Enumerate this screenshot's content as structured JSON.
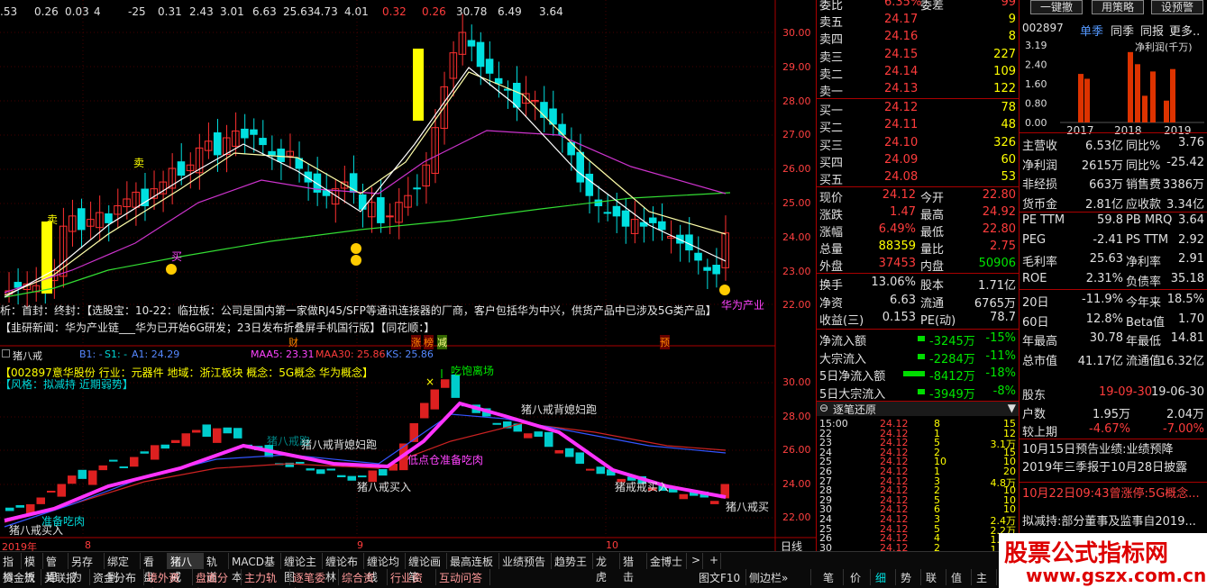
{
  "top_values": [
    {
      "t": ".53",
      "c": "w"
    },
    {
      "t": "0.26",
      "c": "w"
    },
    {
      "t": "0.03",
      "c": "w"
    },
    {
      "t": "4",
      "c": "w"
    },
    {
      "t": "-25",
      "c": "w"
    },
    {
      "t": "0.31",
      "c": "w"
    },
    {
      "t": "2.43",
      "c": "w"
    },
    {
      "t": "3.01",
      "c": "w"
    },
    {
      "t": "6.63",
      "c": "w"
    },
    {
      "t": "25.63",
      "c": "w"
    },
    {
      "t": "4.73",
      "c": "w"
    },
    {
      "t": "4.01",
      "c": "w"
    },
    {
      "t": "0.32",
      "c": "r"
    },
    {
      "t": "0.26",
      "c": "r"
    },
    {
      "t": "30.78",
      "c": "w"
    },
    {
      "t": "6.49",
      "c": "w"
    },
    {
      "t": "3.64",
      "c": "w"
    }
  ],
  "price_axis": [
    "30.00",
    "29.00",
    "28.00",
    "27.00",
    "26.00",
    "25.00",
    "24.00",
    "23.00",
    "22.00"
  ],
  "main_labels": {
    "sell": "卖",
    "sell2": "卖",
    "buy": "买",
    "buy2": "买",
    "huawei": "华为产业"
  },
  "ticker_line1": "析：首封：终封：【选股宝：10-22：临拉板：公司是国内第一家做RJ45/SFP等通讯连接器的厂商，客户包括华为中兴，供货产品中已涉及5G类产品】",
  "ticker_line2": "【韭研新闻：华为产业链___华为已开始6G研发；23日发布折叠屏手机国行版】【同花顺：】",
  "event_marks": {
    "cai": "财",
    "zhang": "涨",
    "lv": "榜",
    "jian": "减",
    "yu": "预"
  },
  "sub_header": {
    "name": "猪八戒",
    "b1": "B1: -",
    "s1": "S1: -",
    "a1": "A1: 24.29",
    "maa5": "MAA5: 23.31",
    "maa30": "MAA30: 25.86",
    "ks": "KS: 25.86"
  },
  "sub_info1": "【002897意华股份 行业：元器件 地域：浙江板块 概念：5G概念 华为概念】",
  "sub_info2": "【风格：拟减持 近期弱势】",
  "sub_axis": [
    "30.00",
    "28.00",
    "26.00",
    "24.00",
    "22.00"
  ],
  "sub_labels": {
    "eat": "吃饱离场",
    "back1": "猪八戒背媳妇跑",
    "back2": "猪八戒背媳妇跑",
    "buy1": "猪八戒买入",
    "buy2": "猪八戒买入",
    "buy3": "猪戒戒买入",
    "buy4": "猪八戒买",
    "ready1": "准备吃肉",
    "ready2": "低点仓准备吃肉",
    "flash": "猪八戒跑"
  },
  "date_axis": {
    "y2019": "2019年",
    "m8": "8",
    "m9": "9",
    "m10": "10",
    "daily": "日线"
  },
  "tabs1": [
    "指标",
    "模板",
    "管理",
    "另存为",
    "绑定到",
    "看盘",
    "猪八戒",
    "轨道",
    "MACD基本",
    "缠论主图",
    "缠论布林",
    "缠论均线",
    "缠论画笔",
    "最高连板",
    "业绩预告",
    "趋势王",
    "龙虎",
    "猎击",
    "金博士"
  ],
  "tabs2": [
    "资金流入",
    "关联报价",
    "资金分布",
    "境外资金",
    "盘面分析",
    "主力轨迹",
    "逐笔委托",
    "综合资讯",
    "行业资讯",
    "互动问答"
  ],
  "tabs3": [
    "图文F10",
    "侧边栏»"
  ],
  "tabs4": [
    "笔",
    "价",
    "细",
    "势",
    "联",
    "值",
    "主"
  ],
  "orderbook_sell": [
    {
      "l": "卖五",
      "p": "24.17",
      "v": "9"
    },
    {
      "l": "卖四",
      "p": "24.16",
      "v": "8"
    },
    {
      "l": "卖三",
      "p": "24.15",
      "v": "227"
    },
    {
      "l": "卖二",
      "p": "24.14",
      "v": "109"
    },
    {
      "l": "卖一",
      "p": "24.13",
      "v": "122"
    }
  ],
  "orderbook_buy": [
    {
      "l": "买一",
      "p": "24.12",
      "v": "78"
    },
    {
      "l": "买二",
      "p": "24.11",
      "v": "48"
    },
    {
      "l": "买三",
      "p": "24.10",
      "v": "326"
    },
    {
      "l": "买四",
      "p": "24.09",
      "v": "60"
    },
    {
      "l": "买五",
      "p": "24.08",
      "v": "53"
    }
  ],
  "weibi": {
    "l": "委比",
    "v": "6.35%",
    "l2": "委差",
    "v2": "99"
  },
  "quote": [
    {
      "l": "现价",
      "v": "24.12",
      "c": "r",
      "l2": "今开",
      "v2": "22.80",
      "c2": "r"
    },
    {
      "l": "涨跌",
      "v": "1.47",
      "c": "r",
      "l2": "最高",
      "v2": "24.92",
      "c2": "r"
    },
    {
      "l": "涨幅",
      "v": "6.49%",
      "c": "r",
      "l2": "最低",
      "v2": "22.80",
      "c2": "r"
    },
    {
      "l": "总量",
      "v": "88359",
      "c": "y",
      "l2": "量比",
      "v2": "2.75",
      "c2": "r"
    },
    {
      "l": "外盘",
      "v": "37453",
      "c": "r",
      "l2": "内盘",
      "v2": "50906",
      "c2": "g"
    }
  ],
  "quote2": [
    {
      "l": "换手",
      "v": "13.06%",
      "l2": "股本",
      "v2": "1.71亿"
    },
    {
      "l": "净资",
      "v": "6.63",
      "l2": "流通",
      "v2": "6765万"
    },
    {
      "l": "收益(三)",
      "v": "0.153",
      "l2": "PE(动)",
      "v2": "78.7"
    }
  ],
  "flows": [
    {
      "l": "净流入额",
      "v": "-3245万",
      "p": "-15%"
    },
    {
      "l": "大宗流入",
      "v": "-2284万",
      "p": "-11%"
    },
    {
      "l": "5日净流入额",
      "v": "-8412万",
      "p": "-18%"
    },
    {
      "l": "5日大宗流入",
      "v": "-3949万",
      "p": "-8%"
    }
  ],
  "tick_header": "逐笔还原",
  "ticks": [
    {
      "t": "15:00",
      "p": "24.12",
      "v": "8",
      "x": "15"
    },
    {
      "t": "22",
      "p": "24.12",
      "v": "1",
      "x": "12"
    },
    {
      "t": "23",
      "p": "24.12",
      "v": "5",
      "x": "3.1万"
    },
    {
      "t": "24",
      "p": "24.12",
      "v": "2",
      "x": "15"
    },
    {
      "t": "25",
      "p": "24.12",
      "v": "10",
      "x": "10"
    },
    {
      "t": "26",
      "p": "24.12",
      "v": "1",
      "x": "20"
    },
    {
      "t": "27",
      "p": "24.12",
      "v": "3",
      "x": "4.8万"
    },
    {
      "t": "28",
      "p": "24.12",
      "v": "2",
      "x": "10"
    },
    {
      "t": "29",
      "p": "24.12",
      "v": "5",
      "x": "10"
    },
    {
      "t": "30",
      "p": "24.12",
      "v": "6",
      "x": "10"
    },
    {
      "t": "24",
      "p": "24.12",
      "v": "3",
      "x": "2.4万"
    },
    {
      "t": "25",
      "p": "24.12",
      "v": "5",
      "x": "2.2万"
    },
    {
      "t": "26",
      "p": "24.12",
      "v": "4",
      "x": "1.0万"
    },
    {
      "t": "30",
      "p": "24.12",
      "v": "2",
      "x": "1.0万"
    }
  ],
  "fin": {
    "b1": "一键撤",
    "b2": "用策略",
    "b3": "设预警",
    "code": "002897",
    "tab1": "单季",
    "tab2": "同季",
    "tab3": "同报",
    "tab4": "更多..",
    "chart_label": "净利润(千万)",
    "y_axis": [
      "3.19",
      "2.40",
      "1.60",
      "0.80",
      "0.00"
    ],
    "years": [
      "2017",
      "2018",
      "2019"
    ]
  },
  "chart_data": {
    "type": "bar",
    "title": "净利润(千万)",
    "categories": [
      "2017",
      "2018",
      "2019"
    ],
    "values": [
      2.0,
      1.8,
      2.9,
      2.4,
      1.1,
      2.1,
      0.9,
      2.2
    ],
    "ylim": [
      0,
      3.19
    ]
  },
  "fin_rows": [
    {
      "l": "主营收",
      "v": "6.53亿",
      "l2": "同比%",
      "v2": "3.76"
    },
    {
      "l": "净利润",
      "v": "2615万",
      "l2": "同比%",
      "v2": "-25.42"
    },
    {
      "l": "非经损",
      "v": "663万",
      "l2": "销售费",
      "v2": "3386万"
    },
    {
      "l": "货币金",
      "v": "2.81亿",
      "l2": "应收款",
      "v2": "3.34亿"
    },
    {
      "l": "PE TTM",
      "v": "59.8",
      "l2": "PB MRQ",
      "v2": "3.64"
    },
    {
      "l": "PEG",
      "v": "-2.41",
      "l2": "PS TTM",
      "v2": "2.92"
    },
    {
      "l": "毛利率",
      "v": "25.63",
      "l2": "净利率",
      "v2": "2.91"
    },
    {
      "l": "ROE",
      "v": "2.31%",
      "l2": "负债率",
      "v2": "35.18"
    },
    {
      "l": "20日",
      "v": "-11.9%",
      "l2": "今年来",
      "v2": "18.5%"
    },
    {
      "l": "60日",
      "v": "12.8%",
      "l2": "Beta值",
      "v2": "1.70"
    },
    {
      "l": "年最高",
      "v": "30.78",
      "l2": "年最低",
      "v2": "14.81"
    },
    {
      "l": "总市值",
      "v": "41.17亿",
      "l2": "流通值",
      "v2": "16.32亿"
    }
  ],
  "holders": {
    "l": "股东",
    "d1": "19-09-30",
    "d2": "19-06-30"
  },
  "holders2": [
    {
      "l": "户数",
      "v": "1.95万",
      "v2": "2.04万"
    },
    {
      "l": "较上期",
      "v": "-4.67%",
      "v2": "-7.00%"
    }
  ],
  "news": [
    "10月15日预告业绩:业绩预降",
    "2019年三季报于10月28日披露",
    "10月22日09:43曾涨停:5G概念...",
    "拟减持:部分董事及监事自2019..."
  ],
  "watermark": {
    "t1": "股票公式指标网",
    "t2": "www.gszx.com.cn"
  }
}
